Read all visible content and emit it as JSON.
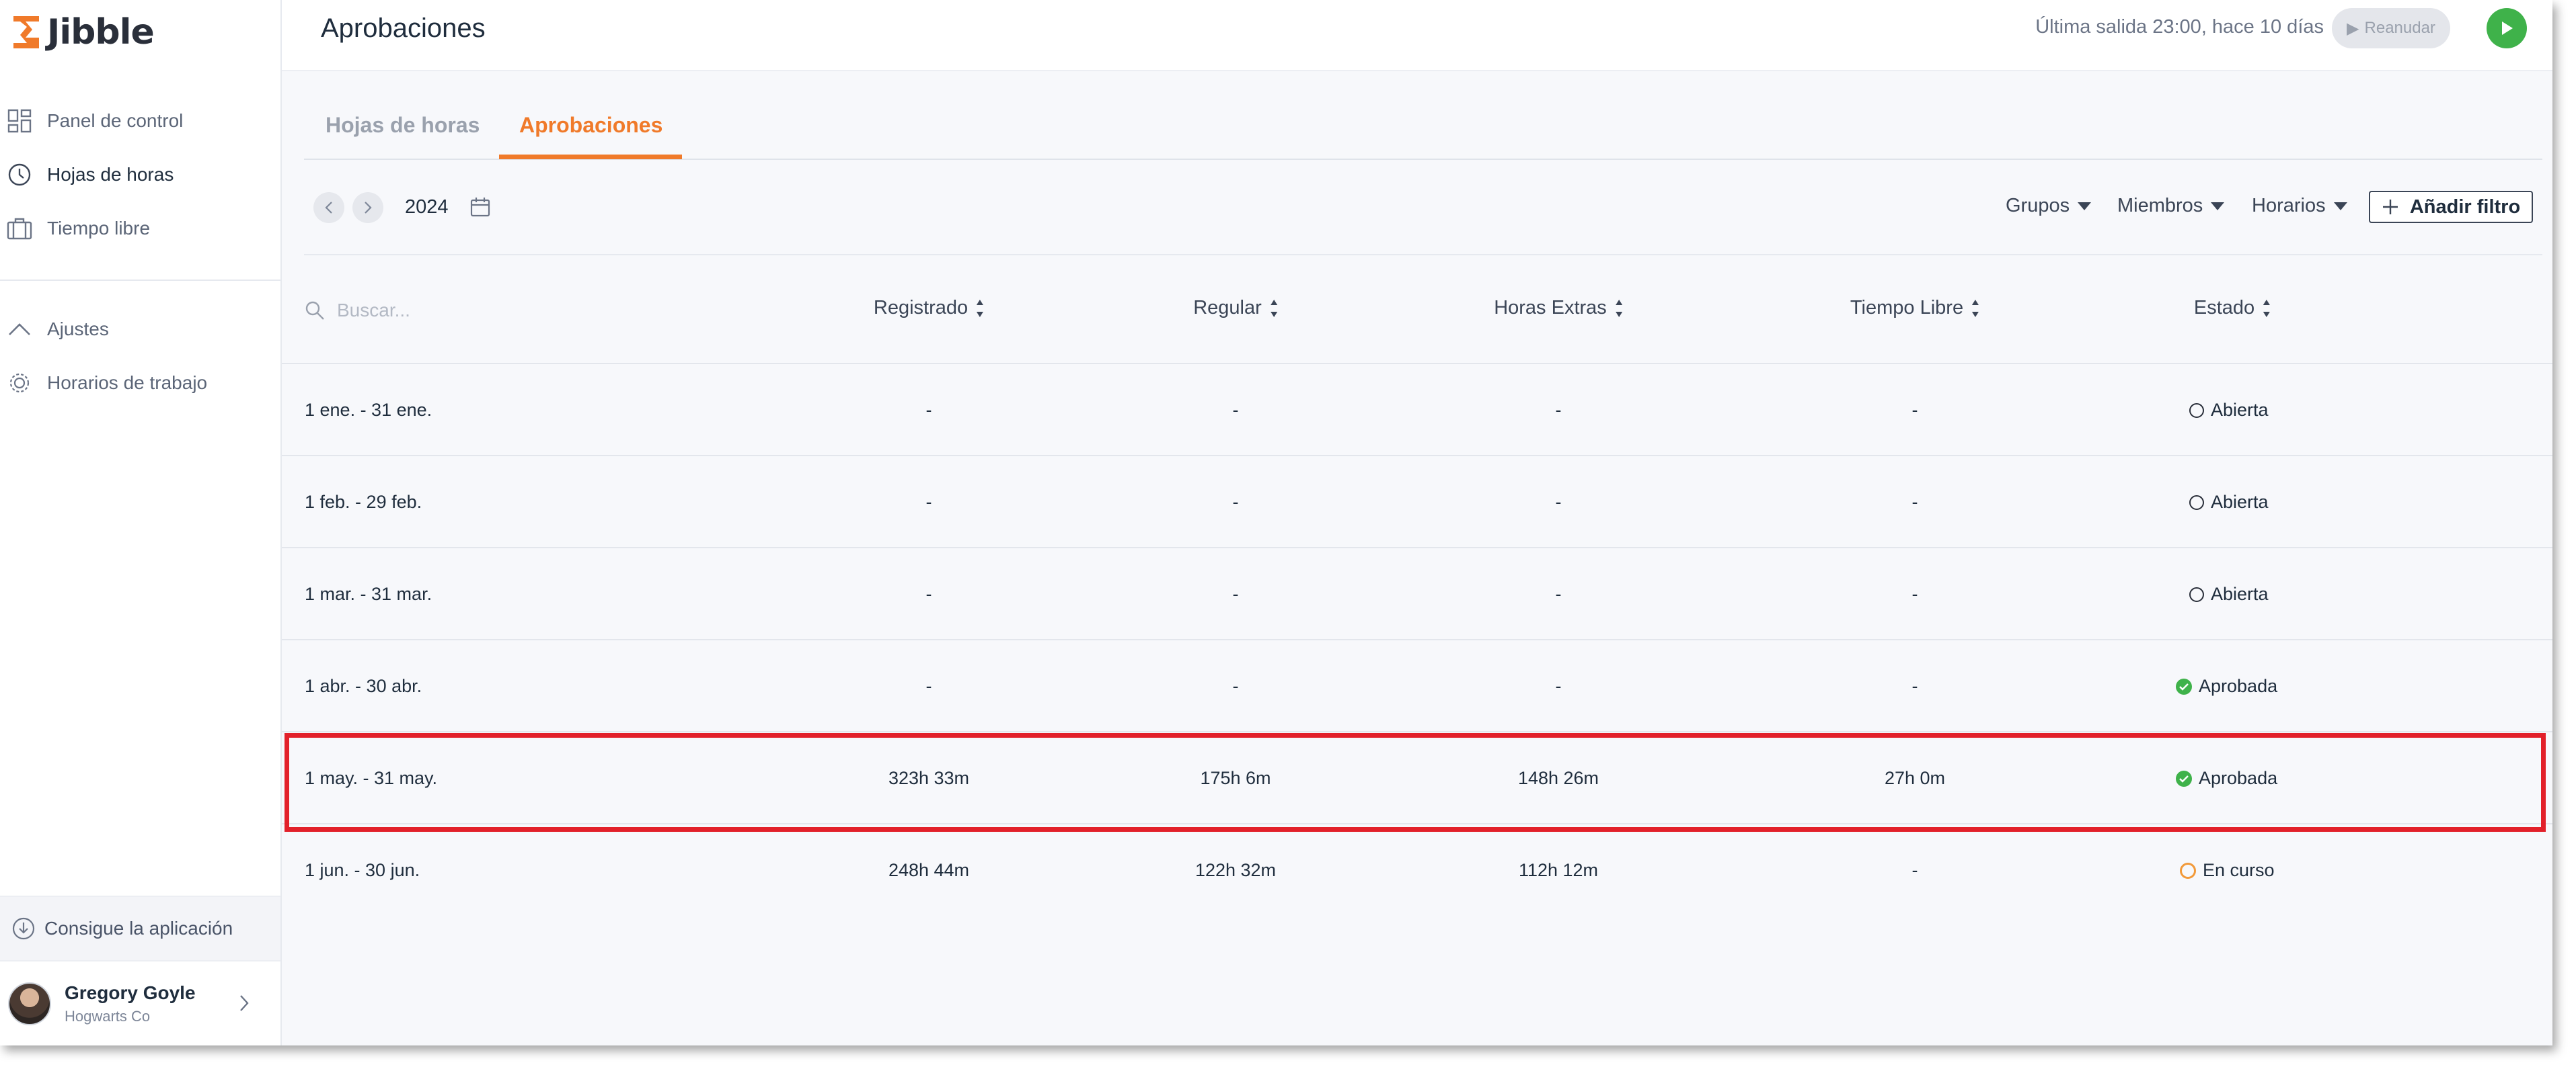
{
  "app": {
    "brand": "Jibble",
    "brand_color": "#f07a2a"
  },
  "sidebar": {
    "items": [
      {
        "label": "Panel de control",
        "icon": "dashboard-icon"
      },
      {
        "label": "Hojas de horas",
        "icon": "clock-icon",
        "active": true
      },
      {
        "label": "Tiempo libre",
        "icon": "suitcase-icon"
      },
      {
        "label": "Ajustes",
        "icon": "chevron-up-icon"
      },
      {
        "label": "Horarios de trabajo",
        "icon": "gear-icon"
      }
    ],
    "get_app": "Consigue la aplicación",
    "user": {
      "name": "Gregory Goyle",
      "org": "Hogwarts Co"
    }
  },
  "header": {
    "title": "Aprobaciones",
    "last_out": "Última salida 23:00, hace 10 días",
    "resume_label": "Reanudar"
  },
  "tabs": [
    {
      "label": "Hojas de horas",
      "active": false
    },
    {
      "label": "Aprobaciones",
      "active": true
    }
  ],
  "toolbar": {
    "year": "2024",
    "filters": [
      "Grupos",
      "Miembros",
      "Horarios"
    ],
    "add_filter": "Añadir filtro"
  },
  "table": {
    "search_placeholder": "Buscar...",
    "columns": [
      "Registrado",
      "Regular",
      "Horas Extras",
      "Tiempo Libre",
      "Estado"
    ],
    "rows": [
      {
        "period": "1 ene. - 31 ene.",
        "registrado": "-",
        "regular": "-",
        "extras": "-",
        "libre": "-",
        "estado": "Abierta",
        "status_type": "open"
      },
      {
        "period": "1 feb. - 29 feb.",
        "registrado": "-",
        "regular": "-",
        "extras": "-",
        "libre": "-",
        "estado": "Abierta",
        "status_type": "open"
      },
      {
        "period": "1 mar. - 31 mar.",
        "registrado": "-",
        "regular": "-",
        "extras": "-",
        "libre": "-",
        "estado": "Abierta",
        "status_type": "open"
      },
      {
        "period": "1 abr. - 30 abr.",
        "registrado": "-",
        "regular": "-",
        "extras": "-",
        "libre": "-",
        "estado": "Aprobada",
        "status_type": "approved"
      },
      {
        "period": "1 may. - 31 may.",
        "registrado": "323h 33m",
        "regular": "175h 6m",
        "extras": "148h 26m",
        "libre": "27h 0m",
        "estado": "Aprobada",
        "status_type": "approved",
        "highlighted": true
      },
      {
        "period": "1 jun. - 30 jun.",
        "registrado": "248h 44m",
        "regular": "122h 32m",
        "extras": "112h 12m",
        "libre": "-",
        "estado": "En curso",
        "status_type": "in-progress"
      }
    ]
  },
  "colors": {
    "accent": "#f07a2a",
    "approved": "#3fb24a",
    "in_progress": "#f29a3a",
    "highlight": "#e2202a"
  }
}
